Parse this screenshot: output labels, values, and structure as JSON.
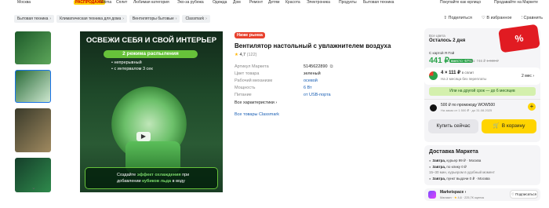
{
  "topbar": {
    "location": "Москва",
    "promo": "РАСПРОДАЖА",
    "links": [
      "Ultima",
      "Сплит",
      "Любимая категория",
      "Эко-за рубежа",
      "Одежда",
      "Дом",
      "Ремонт",
      "Детям",
      "Красота",
      "Электроника",
      "Продукты",
      "Бытовая техника"
    ],
    "right_links": [
      "Покупайте как юрлицо",
      "Продавайте на Маркете"
    ]
  },
  "breadcrumbs": [
    "Бытовая техника",
    "Климатическая техника для дома",
    "Вентиляторы бытовые",
    "Classmark"
  ],
  "actions": {
    "share": "Поделиться",
    "favorite": "В избранное",
    "compare": "Сравнить"
  },
  "gallery": {
    "headline": "ОСВЕЖИ СЕБЯ И СВОЙ ИНТЕРЬЕР",
    "mode_pill": "2 режима распыления",
    "bullets": [
      "• непрерывный",
      "• с интервалом 3 сек"
    ],
    "footer_text_1": "Создайте ",
    "footer_highlight_1": "эффект охлаждения",
    "footer_text_2": " при добавлении ",
    "footer_highlight_2": "кубиков льда",
    "footer_text_3": " в воду"
  },
  "product": {
    "badge": "Ниже рынка",
    "title": "Вентилятор настольный с увлажнителем воздуха",
    "rating": "4,7",
    "reviews": "(122)",
    "specs": [
      {
        "key": "Артикул Маркета",
        "value": "5145622890"
      },
      {
        "key": "Цвет товара",
        "value": "зеленый"
      },
      {
        "key": "Рабочий механизм",
        "value": "осевой"
      },
      {
        "key": "Мощность",
        "value": "6 Вт"
      },
      {
        "key": "Питание",
        "value": "от USB-порта"
      }
    ],
    "all_specs": "Все характеристики ›",
    "brand_link": "Все товары Classmark"
  },
  "buybox": {
    "stock_note": "Все цвета",
    "stock_main": "Осталось 2 дня",
    "card_label": "С картой Я Пэй",
    "price": "441 ₽",
    "discount": "вместо -57%",
    "old_price_prefix": "без: 746 ₽",
    "old_price": "1 030 ₽",
    "split_price": "4 × 111 ₽",
    "split_tag": "в сплит",
    "split_note": "На 2 месяца без переплаты",
    "split_term": "2 мес ›",
    "term_row": "Или на другой срок — до 6 месяцев",
    "promo_line1": "500 ₽ по промокоду WOW500",
    "promo_line2": "На заказ от 1 500 ₽ · до 31.08.2025",
    "buy_now": "Купить сейчас",
    "to_cart": "В корзину",
    "ozon_badge": "%"
  },
  "delivery": {
    "title": "Доставка Маркета",
    "rows": [
      {
        "when": "Завтра,",
        "how": " курьер 99 ₽ · Москва",
        "sub": ""
      },
      {
        "when": "Завтра,",
        "how": " по клику 0 ₽",
        "sub": "15–30 мин, курьером в удобный момент"
      },
      {
        "when": "Завтра,",
        "how": " пункт выдачи 0 ₽ · Москва",
        "sub": ""
      }
    ]
  },
  "seller": {
    "name": "Marketspace ›",
    "meta_prefix": "Магазин · ",
    "meta_rating": "4,6",
    "meta_suffix": " · 225,7К оценок",
    "follow": "Подписаться"
  },
  "colors": {
    "accent_green": "#2aa34a",
    "accent_yellow": "#ffd400",
    "badge_red": "#e8412d",
    "link_blue": "#1a5fb4"
  }
}
